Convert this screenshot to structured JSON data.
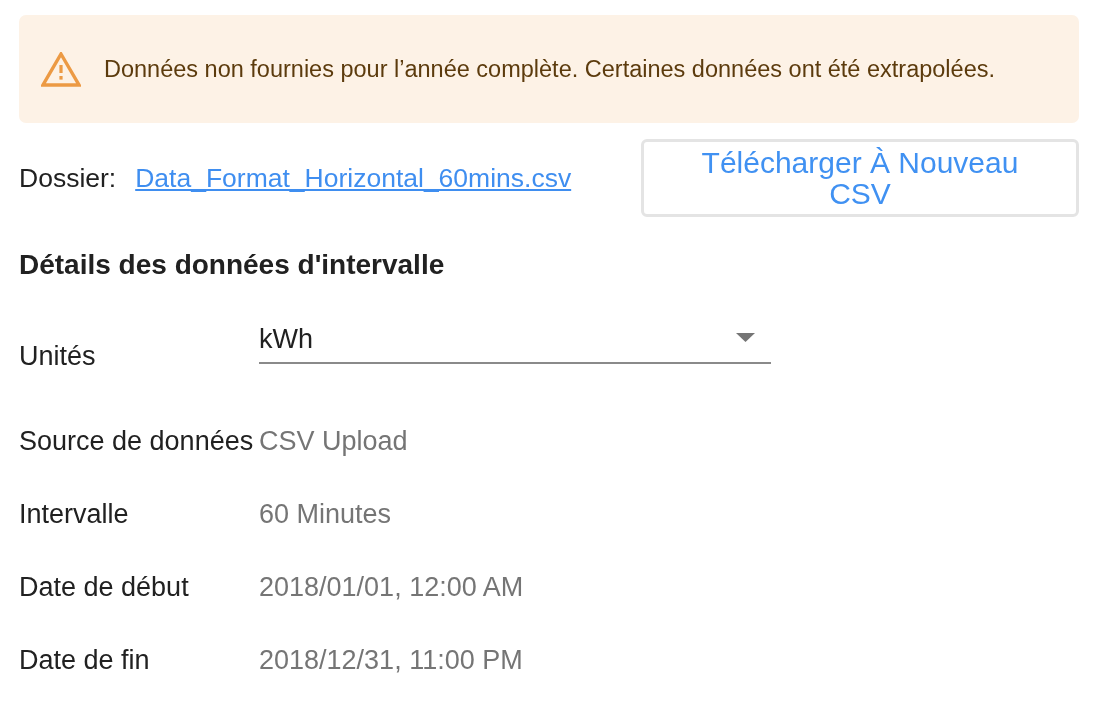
{
  "alert": {
    "message": "Données non fournies pour l’année complète. Certaines données ont été extrapolées."
  },
  "file": {
    "label": "Dossier:",
    "link": "Data_Format_Horizontal_60mins.csv",
    "button": "Télécharger À Nouveau CSV"
  },
  "section": {
    "title": "Détails des données d'intervalle"
  },
  "units": {
    "label": "Unités",
    "value": "kWh"
  },
  "details": [
    {
      "label": "Source de données",
      "value": "CSV Upload"
    },
    {
      "label": "Intervalle",
      "value": "60 Minutes"
    },
    {
      "label": "Date de début",
      "value": "2018/01/01, 12:00 AM"
    },
    {
      "label": "Date de fin",
      "value": "2018/12/31, 11:00 PM"
    }
  ]
}
